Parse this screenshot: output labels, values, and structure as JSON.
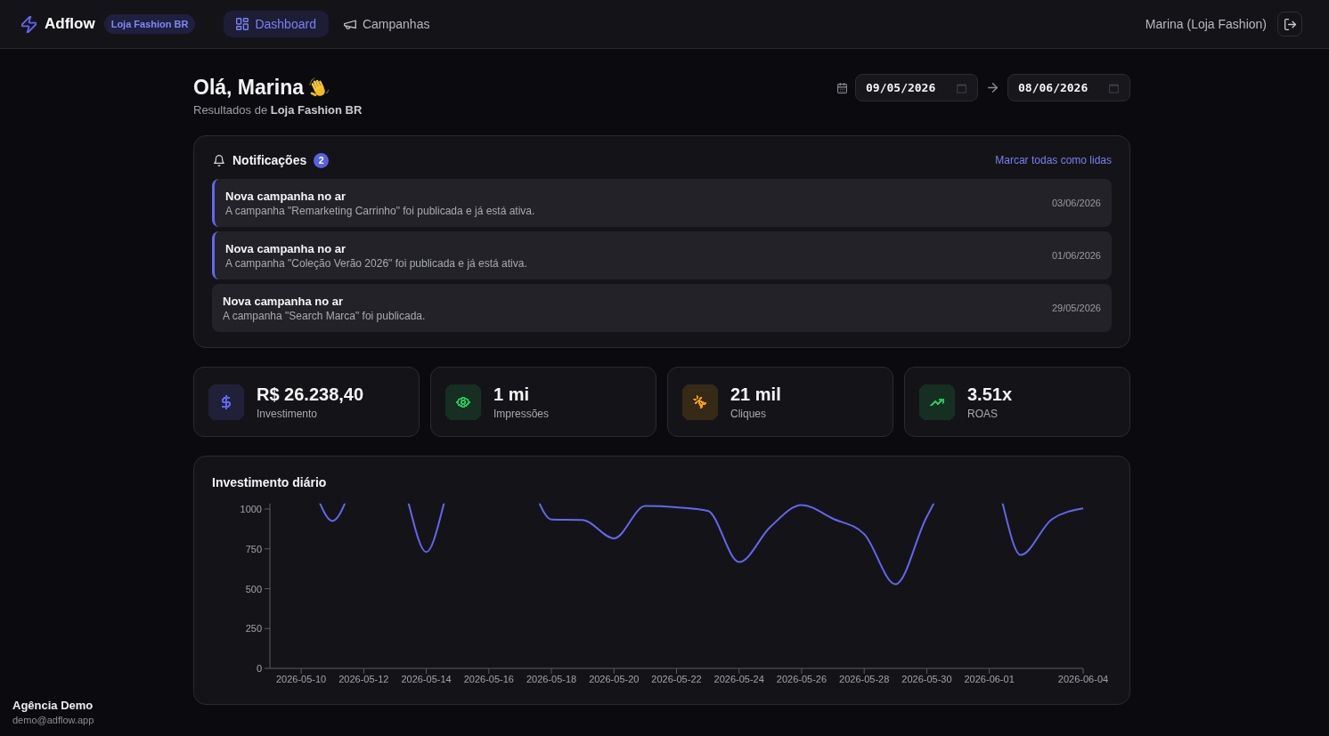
{
  "header": {
    "logo": "Adflow",
    "account_badge": "Loja Fashion BR",
    "nav": [
      {
        "label": "Dashboard",
        "selected": true
      },
      {
        "label": "Campanhas",
        "selected": false
      }
    ],
    "user": "Marina (Loja Fashion)"
  },
  "greeting": {
    "title": "Olá, Marina",
    "subtitle": "Resultados de **Loja Fashion BR**"
  },
  "date_range": {
    "start": "09/05/2026",
    "end": "08/06/2026"
  },
  "notifications": {
    "title": "Notificações",
    "count": "2",
    "action": "Marcar todas como lidas",
    "items": [
      {
        "title": "Nova campanha no ar",
        "message": "A campanha \"Remarketing Carrinho\" foi publicada e já está ativa.",
        "date": "03/06/2026",
        "unread": true
      },
      {
        "title": "Nova campanha no ar",
        "message": "A campanha \"Coleção Verão 2026\" foi publicada e já está ativa.",
        "date": "01/06/2026",
        "unread": true
      },
      {
        "title": "Nova campanha no ar",
        "message": "A campanha \"Search Marca\" foi publicada.",
        "date": "29/05/2026",
        "unread": false
      }
    ]
  },
  "stats": [
    {
      "value": "R$ 26.238,40",
      "label": "Investimento",
      "color": "#6366f1"
    },
    {
      "value": "1 mi",
      "label": "Impressões",
      "color": "#22c55e"
    },
    {
      "value": "21 mil",
      "label": "Cliques",
      "color": "#f59e0b"
    },
    {
      "value": "3.51x",
      "label": "ROAS",
      "color": "#22c55e"
    }
  ],
  "chart": {
    "chart_data": {
      "type": "line",
      "title": "Investimento diário",
      "categories": [
        null,
        "2026-05-10",
        null,
        "2026-05-12",
        null,
        "2026-05-14",
        null,
        "2026-05-16",
        null,
        "2026-05-18",
        null,
        "2026-05-20",
        null,
        "2026-05-22",
        null,
        "2026-05-24",
        null,
        "2026-05-26",
        null,
        "2026-05-28",
        null,
        "2026-05-30",
        null,
        "2026-06-01",
        null,
        null,
        "2026-06-04"
      ],
      "series": [
        {
          "color": "#6366f1",
          "values": [
            null,
            null,
            925,
            null,
            null,
            730,
            null,
            null,
            null,
            935,
            932,
            816,
            1019,
            1011,
            989,
            667,
            888,
            1025,
            940,
            843,
            528,
            951,
            null,
            null,
            712,
            936,
            1004
          ]
        }
      ],
      "ylim": [
        0,
        1035
      ],
      "yticks": [
        0,
        250,
        500,
        750,
        1000
      ]
    }
  },
  "footer": {
    "name": "Agência Demo",
    "email": "demo@adflow.app"
  }
}
